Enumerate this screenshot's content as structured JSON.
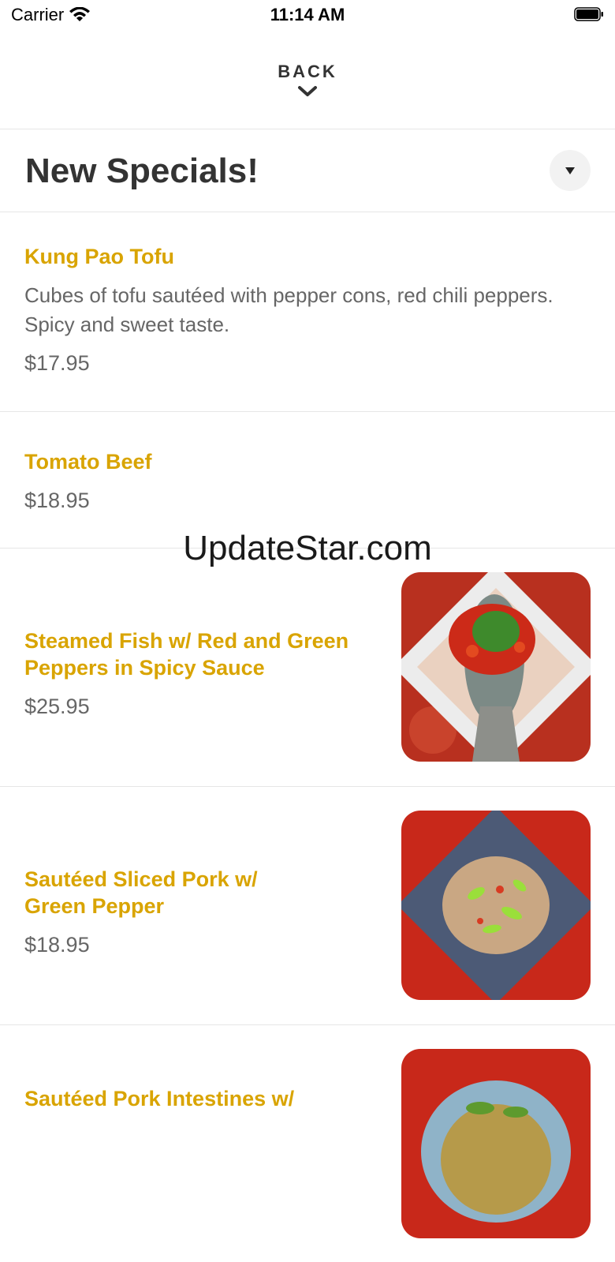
{
  "status_bar": {
    "carrier": "Carrier",
    "time": "11:14 AM"
  },
  "nav": {
    "back_label": "BACK"
  },
  "section": {
    "title": "New Specials!"
  },
  "items": [
    {
      "name": "Kung Pao Tofu",
      "description": "Cubes of tofu sautéed with pepper cons, red chili peppers. Spicy and sweet taste.",
      "price": "$17.95"
    },
    {
      "name": "Tomato Beef",
      "price": "$18.95"
    },
    {
      "name": "Steamed Fish w/ Red and Green Peppers in Spicy Sauce",
      "price": "$25.95",
      "image": "steamed-fish-photo"
    },
    {
      "name": "Sautéed Sliced Pork w/ Green Pepper",
      "price": "$18.95",
      "image": "sliced-pork-photo"
    },
    {
      "name": "Sautéed Pork Intestines w/",
      "image": "pork-intestines-photo"
    }
  ],
  "watermark": "UpdateStar.com",
  "colors": {
    "accent": "#d9a400",
    "text": "#333333",
    "muted": "#666666",
    "divider": "#e6e6e6"
  }
}
